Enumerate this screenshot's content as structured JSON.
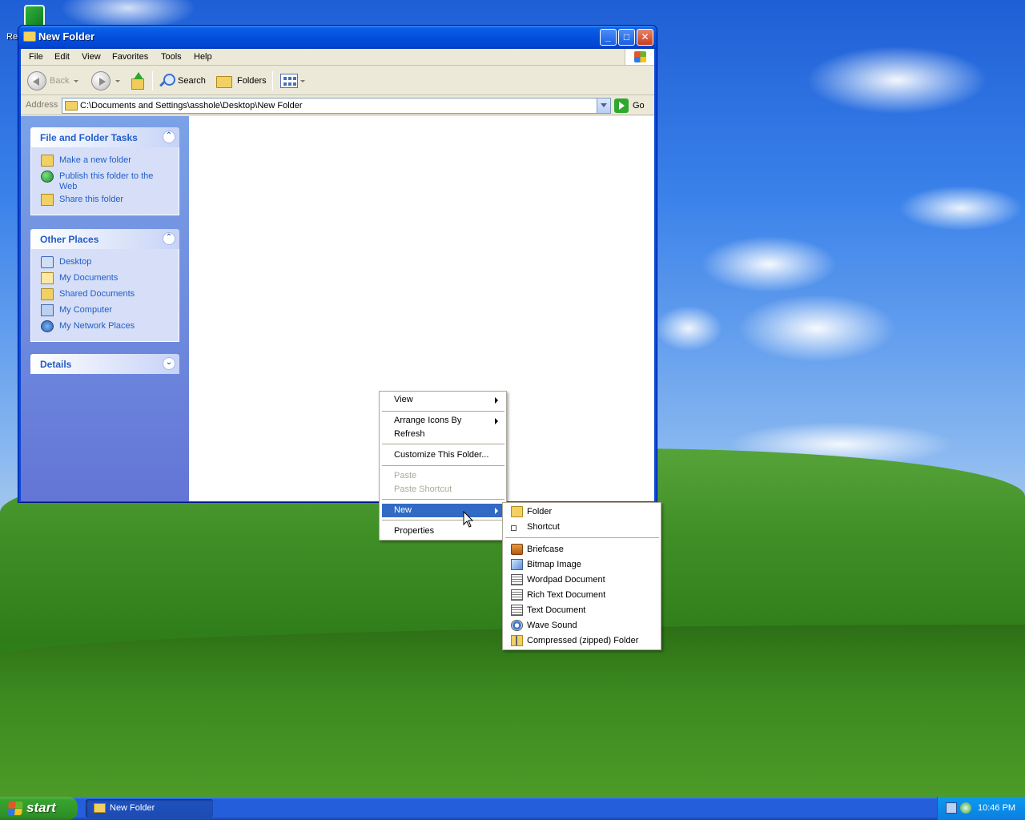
{
  "desktop": {
    "icon_label": "Re"
  },
  "window": {
    "title": "New Folder",
    "buttons": {
      "minimize": "_",
      "maximize": "□",
      "close": "✕"
    }
  },
  "menubar": [
    "File",
    "Edit",
    "View",
    "Favorites",
    "Tools",
    "Help"
  ],
  "toolbar": {
    "back": "Back",
    "search": "Search",
    "folders": "Folders"
  },
  "address": {
    "label": "Address",
    "value": "C:\\Documents and Settings\\asshole\\Desktop\\New Folder",
    "go": "Go"
  },
  "sidebar": {
    "file_tasks": {
      "title": "File and Folder Tasks",
      "collapse": "⌃",
      "items": [
        "Make a new folder",
        "Publish this folder to the Web",
        "Share this folder"
      ]
    },
    "other_places": {
      "title": "Other Places",
      "collapse": "⌃",
      "items": [
        "Desktop",
        "My Documents",
        "Shared Documents",
        "My Computer",
        "My Network Places"
      ]
    },
    "details": {
      "title": "Details",
      "expand": "⌄"
    }
  },
  "context_menu": {
    "view": "View",
    "arrange": "Arrange Icons By",
    "refresh": "Refresh",
    "customize": "Customize This Folder...",
    "paste": "Paste",
    "paste_shortcut": "Paste Shortcut",
    "new": "New",
    "properties": "Properties"
  },
  "new_submenu": {
    "folder": "Folder",
    "shortcut": "Shortcut",
    "items": [
      "Briefcase",
      "Bitmap Image",
      "Wordpad Document",
      "Rich Text Document",
      "Text Document",
      "Wave Sound",
      "Compressed (zipped) Folder"
    ]
  },
  "taskbar": {
    "start": "start",
    "task_button": "New Folder",
    "clock": "10:46 PM"
  },
  "colors": {
    "highlight": "#316ac5",
    "link": "#215dc6",
    "taskbar": "#245edb",
    "start": "#37a32e"
  }
}
